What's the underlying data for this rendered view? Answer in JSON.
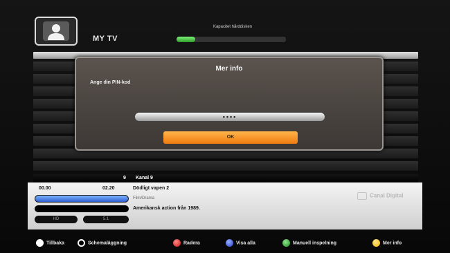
{
  "header": {
    "title": "MY TV",
    "capacity_label": "Kapacitet hårddisken",
    "capacity_fraction": 0.17
  },
  "dialog": {
    "title": "Mer info",
    "prompt": "Ange din PIN-kod",
    "pin_value": "••••",
    "ok_label": "OK"
  },
  "channel": {
    "number": "9",
    "name": "Kanal 9"
  },
  "program": {
    "start": "00.00",
    "end": "02.20",
    "title": "Dödligt vapen 2",
    "genre": "Film/Drama",
    "description": "Amerikansk action från 1989.",
    "progress_fraction": 1.0,
    "badge_hd": "HD",
    "badge_audio": "5.1",
    "brand": "Canal Digital"
  },
  "footer": {
    "back": "Tillbaka",
    "schedule": "Schemaläggning",
    "red": "Radera",
    "blue": "Visa alla",
    "green": "Manuell inspelning",
    "yellow": "Mer info"
  },
  "colors": {
    "accent_orange": "#f07b10",
    "progress_blue": "#2e5fd0",
    "capacity_green": "#2ea02a"
  }
}
